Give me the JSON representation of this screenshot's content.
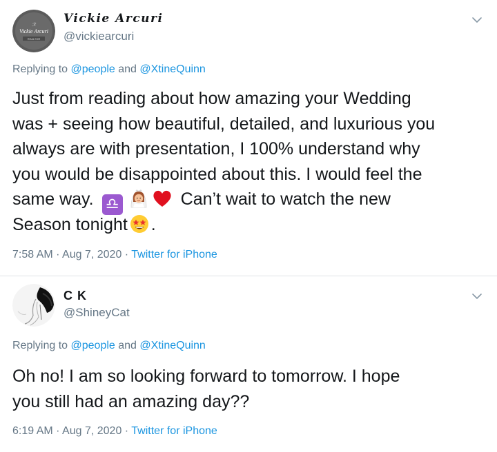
{
  "tweets": [
    {
      "display_name": "Vickie Arcuri",
      "handle": "@vickiearcuri",
      "avatar_text": "Vickie Arcuri",
      "avatar_subtext": "REALTOR",
      "replying_label": "Replying to",
      "replying_to": [
        "@people",
        "@XtineQuinn"
      ],
      "replying_and": "and",
      "body_lines": [
        "Just from reading about how amazing your Wedding",
        "was + seeing how beautiful, detailed, and luxurious you",
        "always are with presentation, I 100% understand why",
        "you would be disappointed about this. I would feel the",
        "same way.",
        "Can’t wait to watch the new",
        "Season tonight",
        "."
      ],
      "emojis": [
        "libra-symbol",
        "woman-with-veil",
        "red-heart",
        "star-struck"
      ],
      "libra_glyph": "♎",
      "time": "7:58 AM",
      "date": "Aug 7, 2020",
      "source": "Twitter for iPhone"
    },
    {
      "display_name": "C K",
      "handle": "@ShineyCat",
      "replying_label": "Replying to",
      "replying_to": [
        "@people",
        "@XtineQuinn"
      ],
      "replying_and": "and",
      "body_lines": [
        "Oh no! I am so looking forward to tomorrow. I hope",
        "you still had an amazing day??"
      ],
      "time": "6:19 AM",
      "date": "Aug 7, 2020",
      "source": "Twitter for iPhone"
    }
  ],
  "colors": {
    "text": "#14171a",
    "secondary": "#657786",
    "link": "#1b95e0",
    "divider": "#dfe3e6",
    "heart": "#e0101f",
    "libra": "#9b59d0"
  }
}
